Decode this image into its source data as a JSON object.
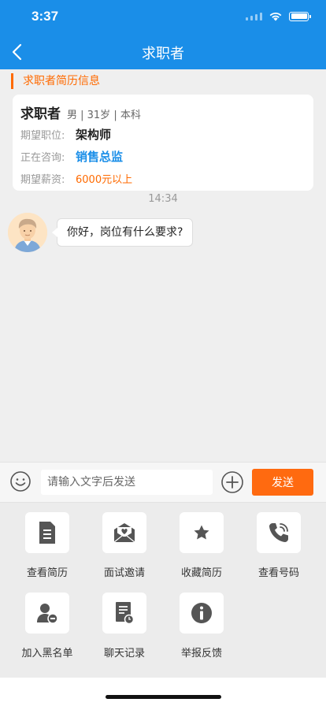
{
  "status_bar": {
    "time": "3:37"
  },
  "header": {
    "title": "求职者"
  },
  "section_label": "求职者简历信息",
  "card": {
    "name": "求职者",
    "meta": "男 | 31岁 | 本科",
    "position_label": "期望职位:",
    "position_value": "架构师",
    "consulting_label": "正在咨询:",
    "consulting_value": "销售总监",
    "salary_label": "期望薪资:",
    "salary_value": "6000元以上"
  },
  "chat": {
    "timestamp": "14:34",
    "messages": [
      {
        "text": "你好，岗位有什么要求?"
      }
    ]
  },
  "input_bar": {
    "placeholder": "请输入文字后发送",
    "send_label": "发送"
  },
  "actions": [
    {
      "label": "查看简历",
      "icon": "resume-icon"
    },
    {
      "label": "面试邀请",
      "icon": "invitation-icon"
    },
    {
      "label": "收藏简历",
      "icon": "star-icon"
    },
    {
      "label": "查看号码",
      "icon": "phone-icon"
    },
    {
      "label": "加入黑名单",
      "icon": "blacklist-icon"
    },
    {
      "label": "聊天记录",
      "icon": "chat-record-icon"
    },
    {
      "label": "举报反馈",
      "icon": "info-icon"
    }
  ],
  "colors": {
    "primary": "#1a8ee8",
    "accent": "#ff6a00",
    "icon": "#555555"
  }
}
